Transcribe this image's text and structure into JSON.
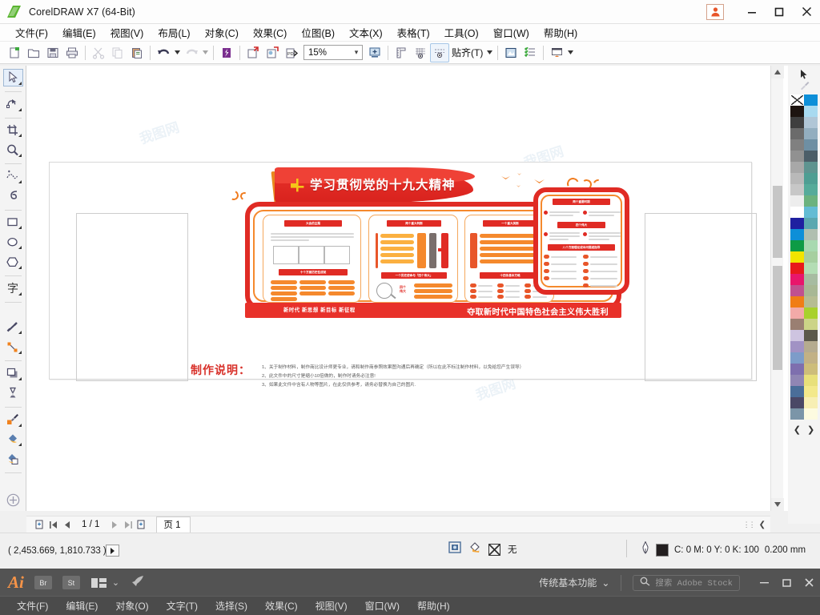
{
  "window": {
    "title": "CorelDRAW X7 (64-Bit)",
    "logo_icon": "coreldraw-logo-icon",
    "user_icon": "user-account-icon",
    "minimize_icon": "minimize-icon",
    "maximize_icon": "maximize-icon",
    "close_icon": "close-icon"
  },
  "menubar": {
    "items": [
      {
        "label": "文件(F)",
        "name": "menu-file"
      },
      {
        "label": "编辑(E)",
        "name": "menu-edit"
      },
      {
        "label": "视图(V)",
        "name": "menu-view"
      },
      {
        "label": "布局(L)",
        "name": "menu-layout"
      },
      {
        "label": "对象(C)",
        "name": "menu-object"
      },
      {
        "label": "效果(C)",
        "name": "menu-effects"
      },
      {
        "label": "位图(B)",
        "name": "menu-bitmap"
      },
      {
        "label": "文本(X)",
        "name": "menu-text"
      },
      {
        "label": "表格(T)",
        "name": "menu-table"
      },
      {
        "label": "工具(O)",
        "name": "menu-tools"
      },
      {
        "label": "窗口(W)",
        "name": "menu-window"
      },
      {
        "label": "帮助(H)",
        "name": "menu-help"
      }
    ]
  },
  "toolbar": {
    "new_icon": "new-document-icon",
    "open_icon": "open-folder-icon",
    "save_icon": "save-icon",
    "print_icon": "print-icon",
    "cut_icon": "cut-scissors-icon",
    "copy_icon": "copy-icon",
    "paste_icon": "paste-icon",
    "undo_icon": "undo-arrow-icon",
    "redo_icon": "redo-arrow-icon",
    "import_icon": "import-icon",
    "export_icon": "export-icon",
    "publish_pdf_icon": "publish-to-pdf-icon",
    "zoom_value": "15%",
    "zoom_caret": "▾",
    "fullscreen_icon": "full-screen-preview-icon",
    "ruler_icon": "show-rulers-icon",
    "grid_icon": "show-grid-icon",
    "guides_icon": "show-guides-icon",
    "snap_label": "贴齐(T)",
    "snap_caret": "▾",
    "options_icon": "options-icon",
    "properties_icon": "object-properties-icon",
    "layout_icon": "page-layout-icon",
    "layout_caret": "▾"
  },
  "toolbox": {
    "items": [
      {
        "name": "tool-pick",
        "icon": "pick-arrow-icon",
        "selected": true
      },
      {
        "name": "tool-shape",
        "icon": "shape-node-edit-icon",
        "selected": false
      },
      {
        "name": "tool-crop",
        "icon": "crop-icon",
        "selected": false
      },
      {
        "name": "tool-zoom",
        "icon": "zoom-magnifier-icon",
        "selected": false
      },
      {
        "name": "tool-freehand",
        "icon": "freehand-curve-icon",
        "selected": false
      },
      {
        "name": "tool-artistic-media",
        "icon": "artistic-media-brush-icon",
        "selected": false
      },
      {
        "name": "tool-rectangle",
        "icon": "rectangle-icon",
        "selected": false
      },
      {
        "name": "tool-ellipse",
        "icon": "ellipse-icon",
        "selected": false
      },
      {
        "name": "tool-polygon",
        "icon": "polygon-icon",
        "selected": false
      },
      {
        "name": "tool-text",
        "icon": "text-tool-icon",
        "selected": false,
        "glyph": "字"
      },
      {
        "name": "tool-parallel-dimension",
        "icon": "dimension-icon",
        "selected": false
      },
      {
        "name": "tool-connector",
        "icon": "connector-line-icon",
        "selected": false
      },
      {
        "name": "tool-shadow",
        "icon": "drop-shadow-icon",
        "selected": false
      },
      {
        "name": "tool-transparency",
        "icon": "transparency-icon",
        "selected": false
      },
      {
        "name": "tool-color-eyedropper",
        "icon": "color-eyedropper-icon",
        "selected": false
      },
      {
        "name": "tool-interactive-fill",
        "icon": "interactive-fill-icon",
        "selected": false
      },
      {
        "name": "tool-smart-fill",
        "icon": "smart-fill-icon",
        "selected": false
      },
      {
        "name": "tool-quick-customize",
        "icon": "quick-customize-plus-icon",
        "selected": false
      }
    ]
  },
  "artwork": {
    "main_title": "学习贯彻党的十九大精神",
    "emblem_icon": "party-hammer-sickle-icon",
    "banner_left": "新时代 新思想 新目标 新征程",
    "banner_right": "夺取新时代中国特色社会主义伟大胜利",
    "panels": [
      {
        "name": "panel-dahui-zhuti",
        "heading": "大会的主题"
      },
      {
        "name": "panel-shige-fangmian",
        "heading": "十个方面历史性成就"
      },
      {
        "name": "panel-liangge-panduan",
        "heading": "两个重大判断"
      },
      {
        "name": "panel-yige-shiming",
        "heading": "一个历史使命与「四个伟大」"
      },
      {
        "name": "panel-yige-zhongda",
        "heading": "一个重大英断"
      },
      {
        "name": "panel-shisi-jianchi",
        "heading": "十四条基本方略"
      },
      {
        "name": "panel-liangge-shidai",
        "heading": "两个重要时期"
      },
      {
        "name": "panel-siwei-guanxi",
        "heading": "四个伟大"
      },
      {
        "name": "panel-bage-mingque",
        "heading": "八个方面理论或本问题或指导"
      }
    ]
  },
  "notes": {
    "title": "制作说明：",
    "lines": [
      "1、关于制作材料，制作商比设计师更专业，请和制作商参照效果图沟通后再确定（所以在此不标注制作材料，以免给您产生误导）",
      "2、此文件中的尺寸是缩小10倍做的，制作时请务必注意!",
      "3、如果此文件中含有人物等图片，在此仅供参考，请务必替换为自己的图片."
    ]
  },
  "pagenav": {
    "add_page_start_icon": "add-page-before-icon",
    "first_icon": "first-page-icon",
    "prev_icon": "previous-page-icon",
    "counter": "1 / 1",
    "next_icon": "next-page-icon",
    "last_icon": "last-page-icon",
    "add_page_end_icon": "add-page-after-icon",
    "tab_label": "页 1"
  },
  "statusbar": {
    "coordinates": "( 2,453.669, 1,810.733 )",
    "coord_expand_icon": "expand-arrow-icon",
    "object_info_icon": "object-info-icon",
    "fill_icon": "fill-bucket-icon",
    "fill_value": "无",
    "outline_icon": "outline-pen-icon",
    "outline_color_hex": "#231f20",
    "outline_color_text": "C: 0 M: 0 Y: 0 K: 100",
    "outline_width": "0.200 mm"
  },
  "palette": {
    "pointer_icon": "palette-pointer-icon",
    "eyedropper_icon": "palette-eyedropper-icon",
    "prev_icon": "❮",
    "next_icon": "❯",
    "colors_left": [
      "none",
      "#1d1410",
      "#3f3f3f",
      "#6b6b6b",
      "#808080",
      "#919191",
      "#a8a8a8",
      "#b9b9b9",
      "#c7c7c7",
      "#ededed",
      "#ffffff",
      "#1f20a0",
      "#0d8fd8",
      "#0d9b45",
      "#f2e400",
      "#e8191b",
      "#e8166b",
      "#c0518f",
      "#f07d16",
      "#f2aaa8",
      "#9a7f72",
      "#cec4e0",
      "#a192c4",
      "#7d9cc9",
      "#7e6fae",
      "#9086b4",
      "#4a6e99",
      "#4a4866",
      "#7b95a8"
    ],
    "colors_right": [
      "#0d8fd8",
      "#a8daf0",
      "#b0c6d6",
      "#93aebf",
      "#6e8fa3",
      "#4c5e68",
      "#5e9490",
      "#4e9e93",
      "#55ab9a",
      "#6bb27e",
      "#63bcd4",
      "#5ba8b0",
      "#b0bfb0",
      "#a8d9b0",
      "#a6cfa0",
      "#b3ddb4",
      "#a7bca1",
      "#a8b894",
      "#b6bd92",
      "#c3cf96",
      "#a8d12c",
      "#ccd487",
      "#5b584a",
      "#b5ab8f",
      "#c2b185",
      "#cdbd7a",
      "#e8e07a",
      "#f3e98b",
      "#f7efb4"
    ]
  },
  "ai_bar": {
    "logo": "Ai",
    "bridge_label": "Br",
    "stock_label": "St",
    "arrange_icon": "arrange-documents-icon",
    "arrange_caret": "⌄",
    "rocket_icon": "rocket-icon",
    "workspace_label": "传统基本功能",
    "workspace_caret": "⌄",
    "search_icon": "search-icon",
    "search_placeholder": "搜索 Adobe Stock",
    "minimize_icon": "minimize-icon",
    "maximize_icon": "maximize-icon",
    "close_icon": "close-icon",
    "menu_items": [
      {
        "label": "文件(F)",
        "name": "ai-menu-file"
      },
      {
        "label": "编辑(E)",
        "name": "ai-menu-edit"
      },
      {
        "label": "对象(O)",
        "name": "ai-menu-object"
      },
      {
        "label": "文字(T)",
        "name": "ai-menu-type"
      },
      {
        "label": "选择(S)",
        "name": "ai-menu-select"
      },
      {
        "label": "效果(C)",
        "name": "ai-menu-effect"
      },
      {
        "label": "视图(V)",
        "name": "ai-menu-view"
      },
      {
        "label": "窗口(W)",
        "name": "ai-menu-window"
      },
      {
        "label": "帮助(H)",
        "name": "ai-menu-help"
      }
    ]
  },
  "watermark": {
    "text": "我图网"
  }
}
